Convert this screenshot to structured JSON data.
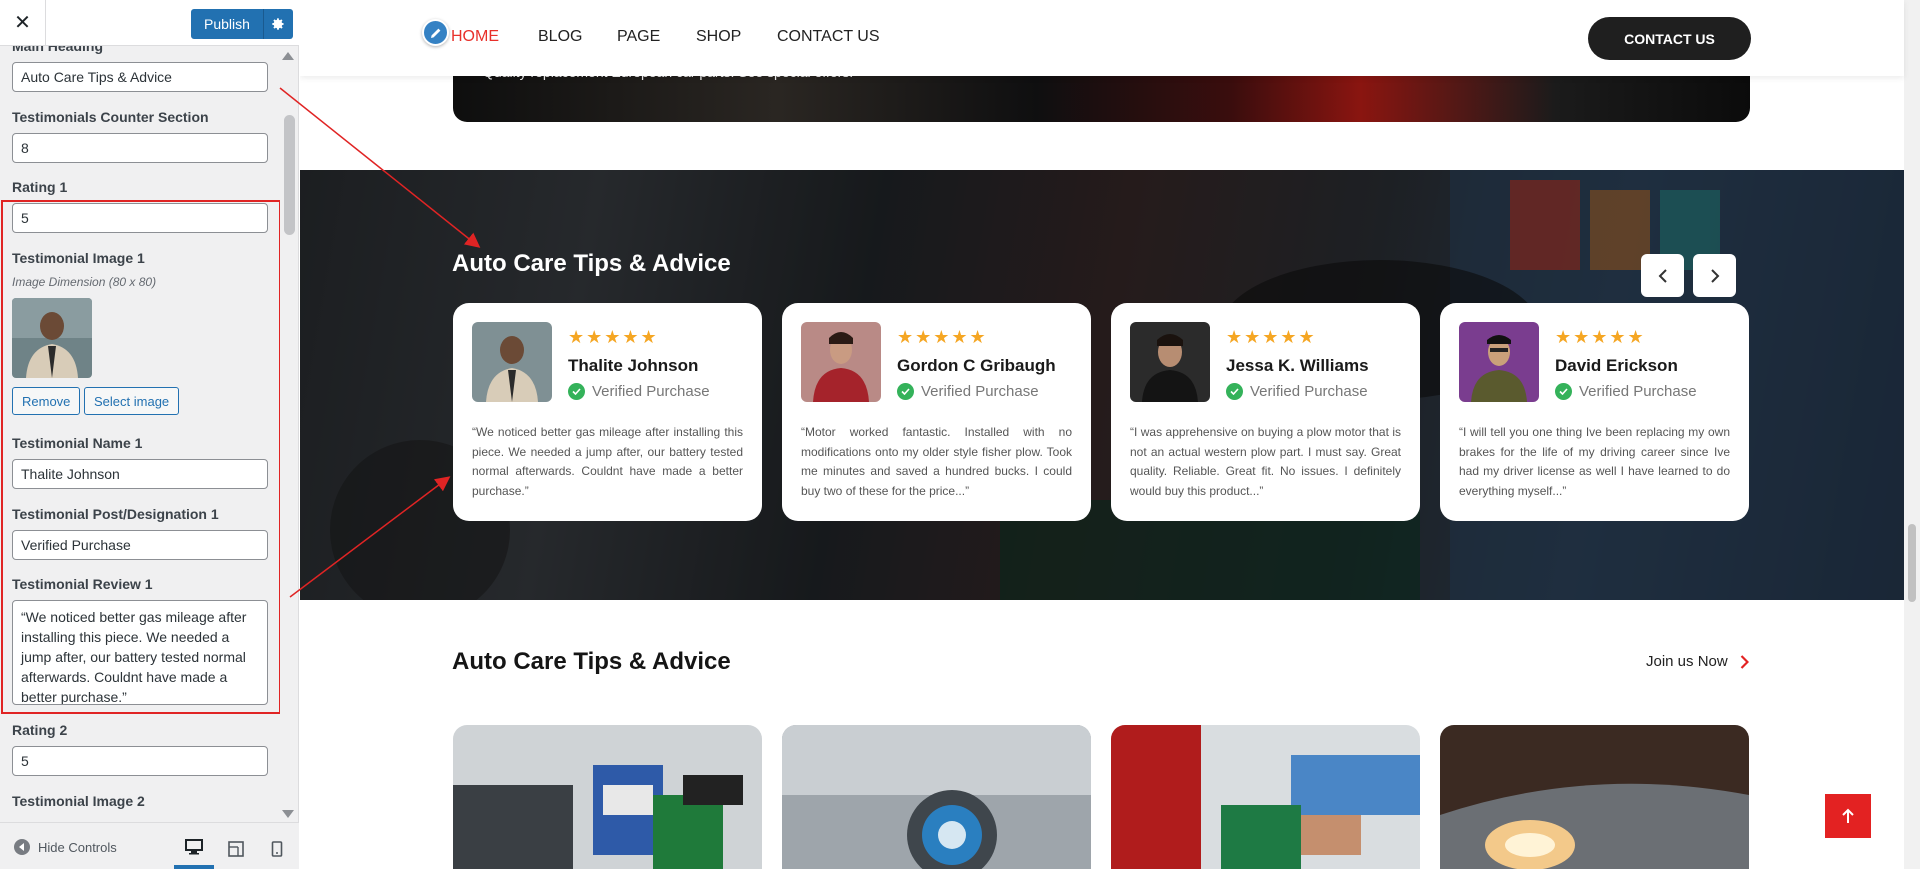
{
  "customizer": {
    "close_icon": "close-icon",
    "publish_label": "Publish",
    "controls": {
      "main_heading_label": "Main Heading",
      "main_heading_value": "Auto Care Tips & Advice",
      "counter_label": "Testimonials Counter Section",
      "counter_value": "8",
      "rating1_label": "Rating 1",
      "rating1_value": "5",
      "image1_label": "Testimonial Image 1",
      "image1_desc": "Image Dimension (80 x 80)",
      "remove_label": "Remove",
      "select_image_label": "Select image",
      "name1_label": "Testimonial Name 1",
      "name1_value": "Thalite Johnson",
      "post1_label": "Testimonial Post/Designation 1",
      "post1_value": "Verified Purchase",
      "review1_label": "Testimonial Review 1",
      "review1_value": "“We noticed better gas mileage after installing this piece. We needed a jump after, our battery tested normal afterwards. Couldnt have made a better purchase.”",
      "rating2_label": "Rating 2",
      "rating2_value": "5",
      "image2_label": "Testimonial Image 2"
    },
    "footer": {
      "hide_controls_label": "Hide Controls"
    }
  },
  "preview": {
    "nav": {
      "items": [
        "HOME",
        "BLOG",
        "PAGE",
        "SHOP",
        "CONTACT US"
      ],
      "active_item": "HOME",
      "cta_label": "CONTACT US"
    },
    "banner_text": "Quality replacement European car parts. See special offers.",
    "testimonials": {
      "title": "Auto Care Tips & Advice",
      "cards": [
        {
          "name": "Thalite Johnson",
          "post": "Verified Purchase",
          "stars": "★★★★★",
          "review": "“We noticed better gas mileage after installing this piece. We needed a jump after, our battery tested normal afterwards. Couldnt have made a better purchase.”"
        },
        {
          "name": "Gordon C Gribaugh",
          "post": "Verified Purchase",
          "stars": "★★★★★",
          "review": "“Motor worked fantastic. Installed with no modifications onto my older style fisher plow. Took me minutes and saved a hundred bucks. I could buy two of these for the price...”"
        },
        {
          "name": "Jessa K. Williams",
          "post": "Verified Purchase",
          "stars": "★★★★★",
          "review": "“I was apprehensive on buying a plow motor that is not an actual western plow part. I must say. Great quality. Reliable. Great fit. No issues. I definitely would buy this product...”"
        },
        {
          "name": "David Erickson",
          "post": "Verified Purchase",
          "stars": "★★★★★",
          "review": "“I will tell you one thing Ive been replacing my own brakes for the life of my driving career since Ive had my driver license as well I have learned to do everything myself...”"
        }
      ]
    },
    "tips": {
      "title": "Auto Care Tips & Advice",
      "join_label": "Join us Now"
    }
  },
  "colors": {
    "wp_blue": "#2271b1",
    "accent_red": "#e8302a",
    "star": "#f5a623",
    "verified_green": "#34b25a"
  }
}
